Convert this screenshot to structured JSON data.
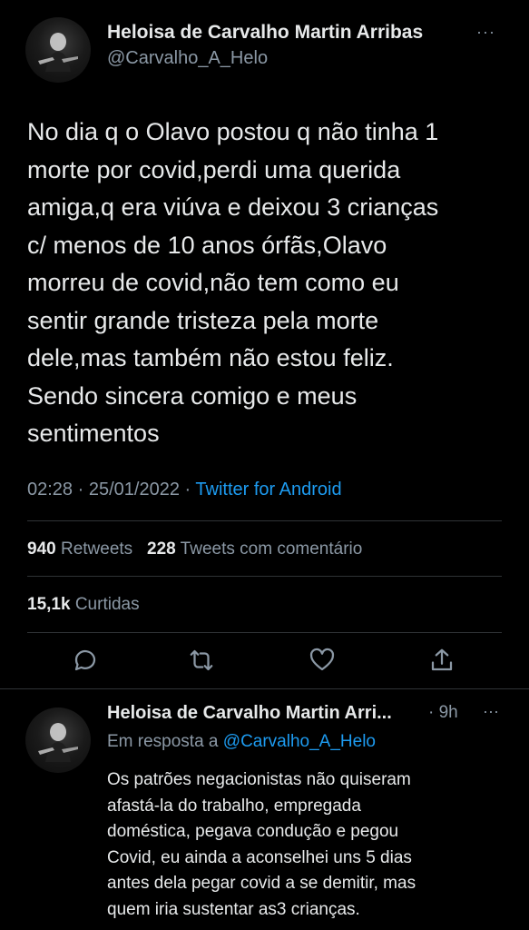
{
  "tweet": {
    "display_name": "Heloisa de Carvalho Martin Arribas",
    "handle": "@Carvalho_A_Helo",
    "more": "···",
    "text": "No dia q o Olavo postou q não tinha 1\nmorte por covid,perdi uma querida\namiga,q era viúva e deixou 3 crianças\nc/ menos de 10 anos órfãs,Olavo\nmorreu de covid,não tem como eu\nsentir grande tristeza pela morte\ndele,mas também não estou feliz.\nSendo sincera comigo e meus\nsentimentos",
    "time": "02:28",
    "date": "25/01/2022",
    "dot": "·",
    "source": "Twitter for Android",
    "retweets_count": "940",
    "retweets_label": "Retweets",
    "quotes_count": "228",
    "quotes_label": "Tweets com comentário",
    "likes_count": "15,1k",
    "likes_label": "Curtidas"
  },
  "actions": {
    "reply_icon": "reply-icon",
    "retweet_icon": "retweet-icon",
    "like_icon": "heart-icon",
    "share_icon": "share-icon"
  },
  "reply": {
    "display_name": "Heloisa de Carvalho Martin Arri...",
    "time": "· 9h",
    "more": "···",
    "replying_prefix": "Em resposta a",
    "replying_to": "@Carvalho_A_Helo",
    "text": "Os patrões negacionistas não quiseram\nafastá-la do trabalho, empregada\ndoméstica, pegava condução e pegou\nCovid, eu ainda a aconselhei uns 5 dias\nantes dela pegar covid a se demitir, mas\nquem iria sustentar as3 crianças."
  },
  "colors": {
    "background": "#000000",
    "text": "#e7e9ea",
    "secondary": "#8b98a5",
    "link": "#1d9bf0",
    "divider": "#2f3336"
  }
}
